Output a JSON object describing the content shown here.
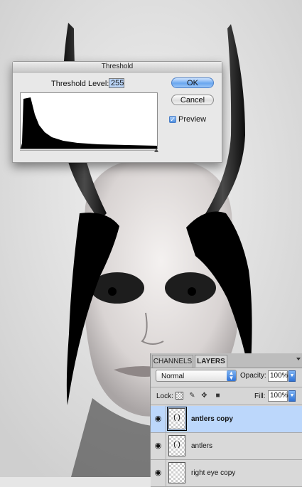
{
  "dialog": {
    "title": "Threshold",
    "level_label": "Threshold Level:",
    "level_value": "255",
    "ok_label": "OK",
    "cancel_label": "Cancel",
    "preview_label": "Preview",
    "preview_checked": true
  },
  "layers_panel": {
    "tabs": [
      "CHANNELS",
      "LAYERS"
    ],
    "active_tab": "LAYERS",
    "blend_mode": "Normal",
    "opacity_label": "Opacity:",
    "opacity_value": "100%",
    "lock_label": "Lock:",
    "fill_label": "Fill:",
    "fill_value": "100%",
    "layers": [
      {
        "name": "antlers copy",
        "visible": true,
        "selected": true
      },
      {
        "name": "antlers",
        "visible": true,
        "selected": false
      },
      {
        "name": "right eye copy",
        "visible": true,
        "selected": false
      }
    ]
  },
  "colors": {
    "selection": "#bcd7fb",
    "ok_button": "#6aa7ef"
  }
}
